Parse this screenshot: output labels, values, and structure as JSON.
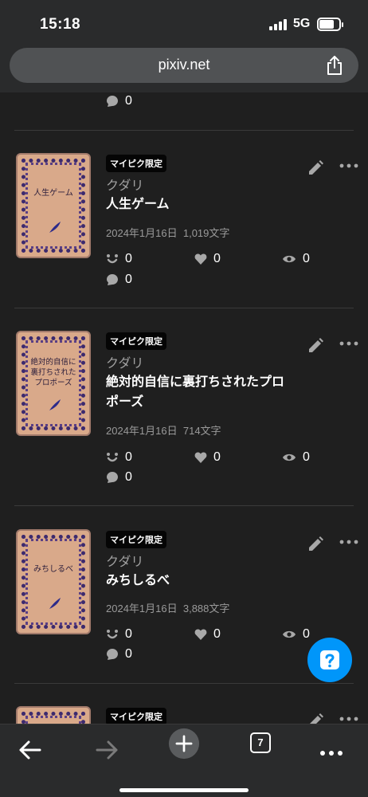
{
  "status": {
    "time": "15:18",
    "network": "5G"
  },
  "browser": {
    "url": "pixiv.net",
    "tab_count": "7"
  },
  "top_partial": {
    "comments": "0"
  },
  "works": [
    {
      "badge": "マイピク限定",
      "author": "クダリ",
      "title": "人生ゲーム",
      "cover_title": "人生ゲーム",
      "date": "2024年1月16日",
      "chars": "1,019文字",
      "reactions": "0",
      "likes": "0",
      "views": "0",
      "comments": "0"
    },
    {
      "badge": "マイピク限定",
      "author": "クダリ",
      "title": "絶対的自信に裏打ちされたプロポーズ",
      "cover_title": "絶対的自信に裏打ちされたプロポーズ",
      "date": "2024年1月16日",
      "chars": "714文字",
      "reactions": "0",
      "likes": "0",
      "views": "0",
      "comments": "0"
    },
    {
      "badge": "マイピク限定",
      "author": "クダリ",
      "title": "みちしるべ",
      "cover_title": "みちしるべ",
      "date": "2024年1月16日",
      "chars": "3,888文字",
      "reactions": "0",
      "likes": "0",
      "views": "0",
      "comments": "0"
    },
    {
      "badge": "マイピク限定"
    }
  ],
  "colors": {
    "background": "#1f1f1f",
    "accent": "#0096fa",
    "badge": "#050505"
  }
}
